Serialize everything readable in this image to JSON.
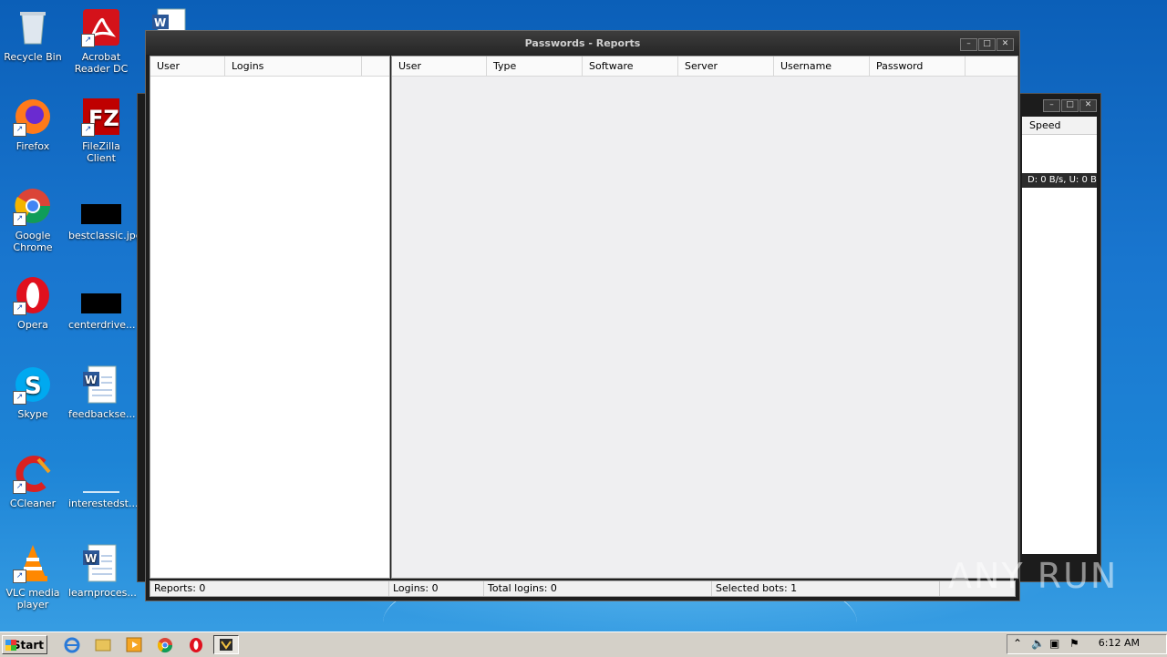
{
  "desktop": {
    "icons": [
      {
        "label": "Recycle Bin"
      },
      {
        "label": "Acrobat Reader DC"
      },
      {
        "label": "Firefox"
      },
      {
        "label": "FileZilla Client"
      },
      {
        "label": "Google Chrome"
      },
      {
        "label": "bestclassic.jpg"
      },
      {
        "label": "Opera"
      },
      {
        "label": "centerdrive..."
      },
      {
        "label": "Skype"
      },
      {
        "label": "feedbackse..."
      },
      {
        "label": "CCleaner"
      },
      {
        "label": "interestedst..."
      },
      {
        "label": "VLC media player"
      },
      {
        "label": "learnproces..."
      }
    ]
  },
  "background_window": {
    "speed_header": "Speed",
    "speed_row": "D: 0 B/s, U: 0 B"
  },
  "main_window": {
    "title": "Passwords - Reports",
    "left_columns": [
      "User",
      "Logins"
    ],
    "right_columns": [
      "User",
      "Type",
      "Software",
      "Server",
      "Username",
      "Password"
    ],
    "status": {
      "reports": "Reports: 0",
      "logins": "Logins: 0",
      "total_logins": "Total logins: 0",
      "selected_bots": "Selected bots: 1"
    }
  },
  "taskbar": {
    "start_label": "Start",
    "clock": "6:12 AM"
  },
  "watermark": "ANY RUN"
}
